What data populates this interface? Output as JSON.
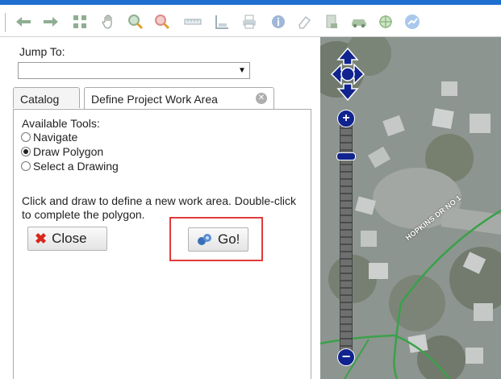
{
  "toolbar": {
    "icons": [
      "back-arrow-icon",
      "forward-arrow-icon",
      "full-extent-icon",
      "pan-hand-icon",
      "zoom-in-icon",
      "zoom-out-icon",
      "measure-ruler-icon",
      "profile-icon",
      "print-icon",
      "info-icon",
      "eraser-icon",
      "report-icon",
      "vehicle-icon",
      "target-icon",
      "chart-icon"
    ]
  },
  "jump": {
    "label": "Jump To:",
    "value": ""
  },
  "tabs": [
    {
      "label": "Catalog"
    },
    {
      "label": "Define Project Work Area"
    }
  ],
  "tools": {
    "label": "Available Tools:",
    "options": [
      {
        "label": "Navigate",
        "checked": false
      },
      {
        "label": "Draw Polygon",
        "checked": true
      },
      {
        "label": "Select a Drawing",
        "checked": false
      }
    ]
  },
  "instructions": "Click and draw to define a new work area. Double-click to complete the polygon.",
  "buttons": {
    "close_label": "Close",
    "go_label": "Go!"
  },
  "map": {
    "street_label": "HOPKINS DR NO 1",
    "zoom_level_fraction": 0.86
  },
  "colors": {
    "topbar": "#1f6fd1",
    "nav_control": "#10238e",
    "highlight": "#e23a3a",
    "close_x": "#d9261c"
  }
}
